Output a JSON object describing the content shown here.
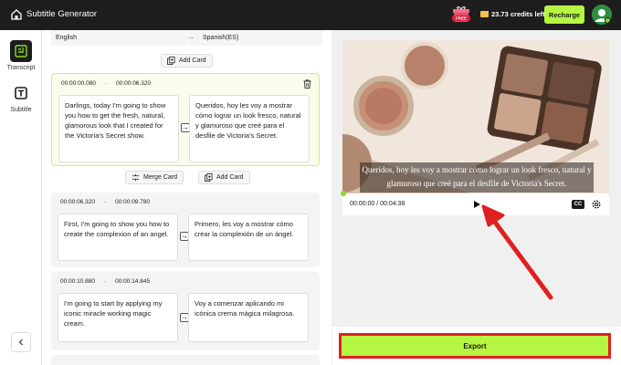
{
  "app": {
    "title": "Subtitle Generator"
  },
  "header": {
    "credits": "23.73 credits left",
    "recharge_label": "Recharge",
    "promo_badge": "FREE"
  },
  "sidebar": {
    "items": [
      {
        "label": "Transcript",
        "icon": "transcript-icon"
      },
      {
        "label": "Subtitle",
        "icon": "subtitle-icon"
      }
    ]
  },
  "languages": {
    "source": "English",
    "target": "Spanish(ES)"
  },
  "actions": {
    "add_card": "Add Card",
    "merge_card": "Merge Card"
  },
  "cards": [
    {
      "start": "00:00:00.080",
      "end": "00:00:06.320",
      "source": "Darlings, today I'm going to show you how to get the fresh, natural, glamorous look that I created for the Victoria's Secret show.",
      "target": "Queridos, hoy les voy a mostrar cómo lograr un look fresco, natural y glamuroso que creé para el desfile de Victoria's Secret."
    },
    {
      "start": "00:00:06.320",
      "end": "00:00:09.780",
      "source": "First, I'm going to show you how to create the complexion of an angel.",
      "target": "Primero, les voy a mostrar cómo crear la complexión de un ángel."
    },
    {
      "start": "00:00:10.880",
      "end": "00:00:14.845",
      "source": "I'm going to start by applying my iconic miracle working magic cream.",
      "target": "Voy a comenzar aplicando mi icónica crema mágica milagrosa."
    }
  ],
  "player": {
    "subtitle": "Queridos, hoy les voy a mostrar cómo lograr un look fresco, natural y glamuroso que creé para el desfile de Victoria's Secret.",
    "timecode": "00:00:00 / 00:04:38",
    "cc_label": "CC",
    "progress": 0
  },
  "export_label": "Export",
  "colors": {
    "accent": "#b6f542",
    "highlight": "#e02020",
    "topbar": "#1d1d1d"
  }
}
